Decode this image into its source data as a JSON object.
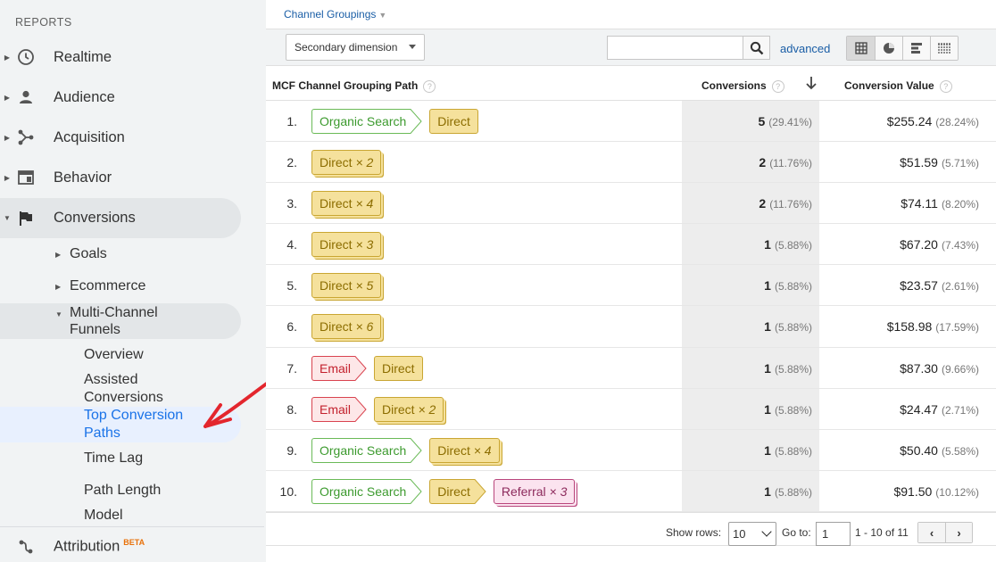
{
  "sidebar": {
    "heading": "REPORTS",
    "top_items": [
      {
        "label": "Realtime",
        "icon": "clock-icon"
      },
      {
        "label": "Audience",
        "icon": "person-icon"
      },
      {
        "label": "Acquisition",
        "icon": "acquisition-icon"
      },
      {
        "label": "Behavior",
        "icon": "behavior-icon"
      },
      {
        "label": "Conversions",
        "icon": "flag-icon"
      }
    ],
    "conversions_children": {
      "goals": "Goals",
      "ecommerce": "Ecommerce",
      "mcf_line1": "Multi-Channel",
      "mcf_line2": "Funnels"
    },
    "mcf_children": {
      "overview": "Overview",
      "assisted_line1": "Assisted",
      "assisted_line2": "Conversions",
      "top_paths_line1": "Top Conversion",
      "top_paths_line2": "Paths",
      "time_lag": "Time Lag",
      "path_length": "Path Length",
      "model": "Model"
    },
    "attribution": {
      "label": "Attribution",
      "badge": "BETA",
      "icon": "attribution-icon"
    }
  },
  "main": {
    "channel_groupings": "Channel Groupings",
    "secondary_dimension": "Secondary dimension",
    "search_placeholder": "",
    "advanced": "advanced",
    "view_icons": [
      "table-view-icon",
      "pie-view-icon",
      "bar-view-icon",
      "pivot-view-icon"
    ],
    "columns": {
      "path": "MCF Channel Grouping Path",
      "conversions": "Conversions",
      "value": "Conversion Value"
    },
    "rows": [
      {
        "num": "1.",
        "path": [
          {
            "type": "organic",
            "text": "Organic Search",
            "mult": ""
          },
          {
            "type": "direct",
            "text": "Direct",
            "mult": ""
          }
        ],
        "conv": "5",
        "conv_pct": "(29.41%)",
        "val": "$255.24",
        "val_pct": "(28.24%)"
      },
      {
        "num": "2.",
        "path": [
          {
            "type": "direct",
            "text": "Direct",
            "mult": "× 2"
          }
        ],
        "conv": "2",
        "conv_pct": "(11.76%)",
        "val": "$51.59",
        "val_pct": "(5.71%)"
      },
      {
        "num": "3.",
        "path": [
          {
            "type": "direct",
            "text": "Direct",
            "mult": "× 4"
          }
        ],
        "conv": "2",
        "conv_pct": "(11.76%)",
        "val": "$74.11",
        "val_pct": "(8.20%)"
      },
      {
        "num": "4.",
        "path": [
          {
            "type": "direct",
            "text": "Direct",
            "mult": "× 3"
          }
        ],
        "conv": "1",
        "conv_pct": "(5.88%)",
        "val": "$67.20",
        "val_pct": "(7.43%)"
      },
      {
        "num": "5.",
        "path": [
          {
            "type": "direct",
            "text": "Direct",
            "mult": "× 5"
          }
        ],
        "conv": "1",
        "conv_pct": "(5.88%)",
        "val": "$23.57",
        "val_pct": "(2.61%)"
      },
      {
        "num": "6.",
        "path": [
          {
            "type": "direct",
            "text": "Direct",
            "mult": "× 6"
          }
        ],
        "conv": "1",
        "conv_pct": "(5.88%)",
        "val": "$158.98",
        "val_pct": "(17.59%)"
      },
      {
        "num": "7.",
        "path": [
          {
            "type": "email",
            "text": "Email",
            "mult": ""
          },
          {
            "type": "direct",
            "text": "Direct",
            "mult": ""
          }
        ],
        "conv": "1",
        "conv_pct": "(5.88%)",
        "val": "$87.30",
        "val_pct": "(9.66%)"
      },
      {
        "num": "8.",
        "path": [
          {
            "type": "email",
            "text": "Email",
            "mult": ""
          },
          {
            "type": "direct",
            "text": "Direct",
            "mult": "× 2"
          }
        ],
        "conv": "1",
        "conv_pct": "(5.88%)",
        "val": "$24.47",
        "val_pct": "(2.71%)"
      },
      {
        "num": "9.",
        "path": [
          {
            "type": "organic",
            "text": "Organic Search",
            "mult": ""
          },
          {
            "type": "direct",
            "text": "Direct",
            "mult": "× 4"
          }
        ],
        "conv": "1",
        "conv_pct": "(5.88%)",
        "val": "$50.40",
        "val_pct": "(5.58%)"
      },
      {
        "num": "10.",
        "path": [
          {
            "type": "organic",
            "text": "Organic Search",
            "mult": ""
          },
          {
            "type": "direct",
            "text": "Direct",
            "mult": ""
          },
          {
            "type": "referral",
            "text": "Referral",
            "mult": "× 3"
          }
        ],
        "conv": "1",
        "conv_pct": "(5.88%)",
        "val": "$91.50",
        "val_pct": "(10.12%)"
      }
    ],
    "footer": {
      "show_rows_label": "Show rows:",
      "show_rows_value": "10",
      "goto_label": "Go to:",
      "goto_value": "1",
      "range": "1 - 10 of 11",
      "prev": "‹",
      "next": "›"
    }
  },
  "colors": {
    "selected_link": "#1a73e8",
    "organic": "#3c9a2e",
    "direct_bg": "#f5e19c",
    "email": "#d9434f",
    "referral": "#b9467c",
    "annotation_arrow": "#e3262d"
  }
}
